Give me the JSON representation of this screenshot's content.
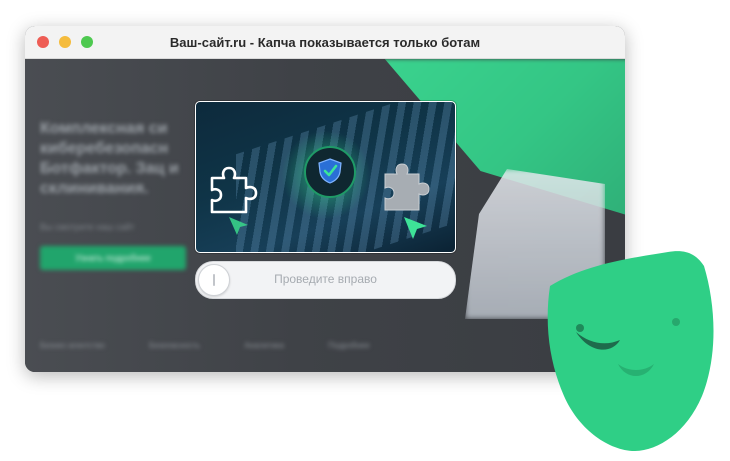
{
  "window": {
    "title": "Ваш-сайт.ru - Капча показывается только ботам"
  },
  "background_page": {
    "headline": "Комплексная си киберебезопасн Ботфактор. Зац и склинивания.",
    "subtext": "Вы смотрите наш сайт",
    "cta_label": "Узнать подробнее",
    "footer_items": [
      "Бизнес-агентство",
      "Безопасность",
      "Аналитика",
      "Подробнее"
    ]
  },
  "captcha": {
    "slider_label": "Проведите вправо",
    "accent": "#2ed38a"
  },
  "icons": {
    "shield": "shield-check-icon",
    "puzzle_left": "puzzle-outline-icon",
    "puzzle_right": "puzzle-filled-icon",
    "cursor": "cursor-arrow-icon",
    "mask": "green-mask-icon"
  },
  "colors": {
    "brand_green": "#2ed38a",
    "mask_green": "#2fcf86"
  }
}
